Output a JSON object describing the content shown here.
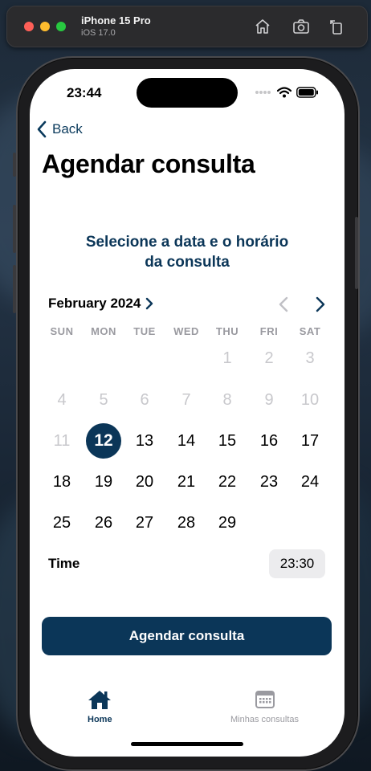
{
  "simulator": {
    "device_name": "iPhone 15 Pro",
    "os_version": "iOS 17.0"
  },
  "status_bar": {
    "time": "23:44"
  },
  "nav": {
    "back_label": "Back"
  },
  "page": {
    "title": "Agendar consulta",
    "heading_line1": "Selecione a data e o horário",
    "heading_line2": "da consulta"
  },
  "calendar": {
    "month_label": "February 2024",
    "weekdays": [
      "SUN",
      "MON",
      "TUE",
      "WED",
      "THU",
      "FRI",
      "SAT"
    ],
    "weeks": [
      [
        "",
        "",
        "",
        "",
        "1",
        "2",
        "3"
      ],
      [
        "4",
        "5",
        "6",
        "7",
        "8",
        "9",
        "10"
      ],
      [
        "11",
        "12",
        "13",
        "14",
        "15",
        "16",
        "17"
      ],
      [
        "18",
        "19",
        "20",
        "21",
        "22",
        "23",
        "24"
      ],
      [
        "25",
        "26",
        "27",
        "28",
        "29",
        "",
        ""
      ]
    ],
    "selected_day": "12",
    "disabled_before_day": 12
  },
  "time_picker": {
    "label": "Time",
    "value": "23:30"
  },
  "primary_button": {
    "label": "Agendar consulta"
  },
  "tab_bar": {
    "items": [
      {
        "label": "Home",
        "icon": "house-icon",
        "active": true
      },
      {
        "label": "Minhas consultas",
        "icon": "calendar-icon",
        "active": false
      }
    ]
  },
  "colors": {
    "accent": "#0b3658",
    "muted_text": "#c8c8cc",
    "inactive_tab": "#9a9aa0"
  }
}
